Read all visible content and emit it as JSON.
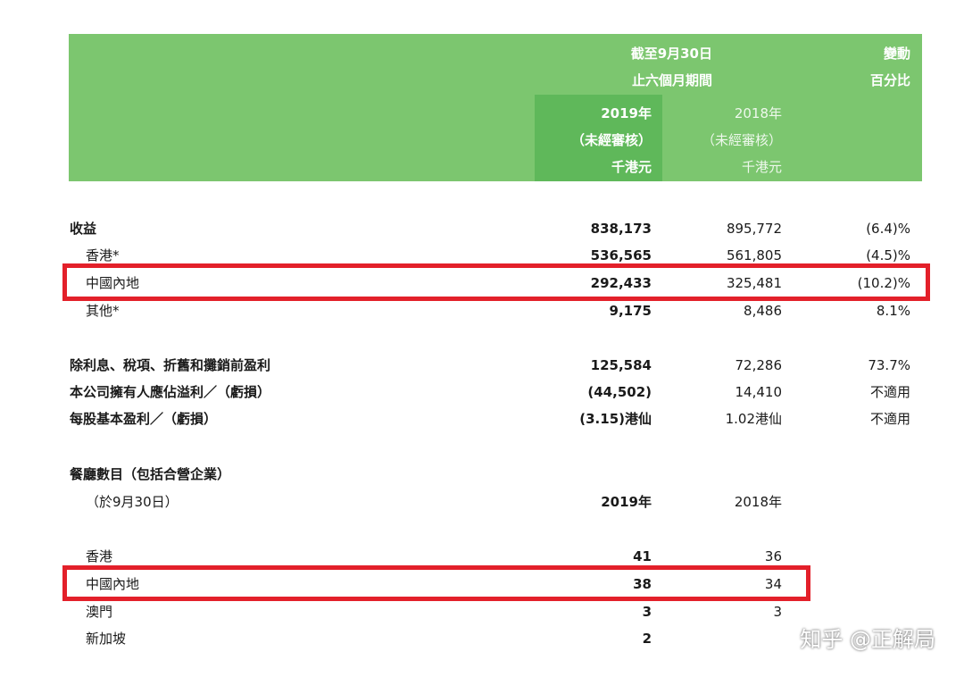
{
  "header": {
    "period_line1": "截至9月30日",
    "period_line2": "止六個月期間",
    "change_line1": "變動",
    "change_line2": "百分比",
    "col2019": {
      "year": "2019年",
      "audit": "（未經審核）",
      "unit": "千港元"
    },
    "col2018": {
      "year": "2018年",
      "audit": "（未經審核）",
      "unit": "千港元"
    }
  },
  "revenue_rows": [
    {
      "label": "收益",
      "v2019": "838,173",
      "v2018": "895,772",
      "change": "(6.4)%"
    },
    {
      "label": "香港*",
      "v2019": "536,565",
      "v2018": "561,805",
      "change": "(4.5)%"
    },
    {
      "label": "中國內地",
      "v2019": "292,433",
      "v2018": "325,481",
      "change": "(10.2)%"
    },
    {
      "label": "其他*",
      "v2019": "9,175",
      "v2018": "8,486",
      "change": "8.1%"
    }
  ],
  "profit_rows": [
    {
      "label": "除利息、稅項、折舊和攤銷前盈利",
      "v2019": "125,584",
      "v2018": "72,286",
      "change": "73.7%"
    },
    {
      "label": "本公司擁有人應佔溢利／（虧損）",
      "v2019": "(44,502)",
      "v2018": "14,410",
      "change": "不適用"
    },
    {
      "label": "每股基本盈利／（虧損）",
      "v2019": "(3.15)港仙",
      "v2018": "1.02港仙",
      "change": "不適用"
    }
  ],
  "restaurants": {
    "title": "餐廳數目（包括合營企業）",
    "subtitle": "（於9月30日）",
    "year2019": "2019年",
    "year2018": "2018年",
    "rows": [
      {
        "label": "香港",
        "v2019": "41",
        "v2018": "36"
      },
      {
        "label": "中國內地",
        "v2019": "38",
        "v2018": "34"
      },
      {
        "label": "澳門",
        "v2019": "3",
        "v2018": "3"
      },
      {
        "label": "新加坡",
        "v2019": "2",
        "v2018": ""
      }
    ]
  },
  "watermark": "知乎 @正解局",
  "colors": {
    "header_green": "#7cc66f",
    "highlight_green": "#5fb85a",
    "box_red": "#e3202a"
  }
}
